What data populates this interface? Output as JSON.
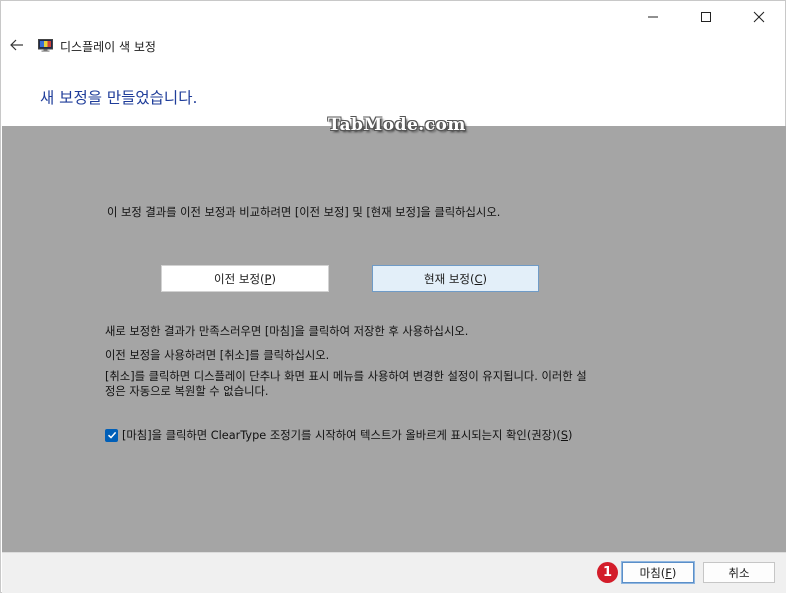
{
  "window": {
    "title": "디스플레이 색 보정",
    "caption_buttons": [
      "minimize-icon",
      "maximize-icon",
      "close-icon"
    ]
  },
  "heading": "새 보정을 만들었습니다.",
  "watermark": "TabMode.com",
  "instruction": "이 보정 결과를 이전 보정과 비교하려면 [이전 보정] 및 [현재 보정]을 클릭하십시오.",
  "buttons": {
    "previous": {
      "label": "이전 보정(",
      "mnemonic": "P",
      "close": ")"
    },
    "current": {
      "label": "현재 보정(",
      "mnemonic": "C",
      "close": ")"
    }
  },
  "paragraphs": {
    "finish_info": "새로 보정한 결과가 만족스러우면 [마침]을 클릭하여 저장한 후 사용하십시오.",
    "cancel_info": "이전 보정을 사용하려면 [취소]를 클릭하십시오.",
    "note_line1": "[취소]를 클릭하면 디스플레이 단추나 화면 표시 메뉴를 사용하여 변경한 설정이 유지됩니다. 이러한 설",
    "note_line2": "정은 자동으로 복원할 수 없습니다."
  },
  "checkbox": {
    "checked": true,
    "label": "[마침]을 클릭하면 ClearType 조정기를 시작하여 텍스트가 올바르게 표시되는지 확인(권장)(",
    "mnemonic": "S",
    "close": ")"
  },
  "footer": {
    "step_badge": "1",
    "finish": {
      "label": "마침(",
      "mnemonic": "F",
      "close": ")"
    },
    "cancel": {
      "label": "취소"
    }
  },
  "colors": {
    "heading": "#1f3d9a",
    "content_bg": "#a5a5a5",
    "checkbox": "#005fb8",
    "badge": "#d31d2a"
  }
}
